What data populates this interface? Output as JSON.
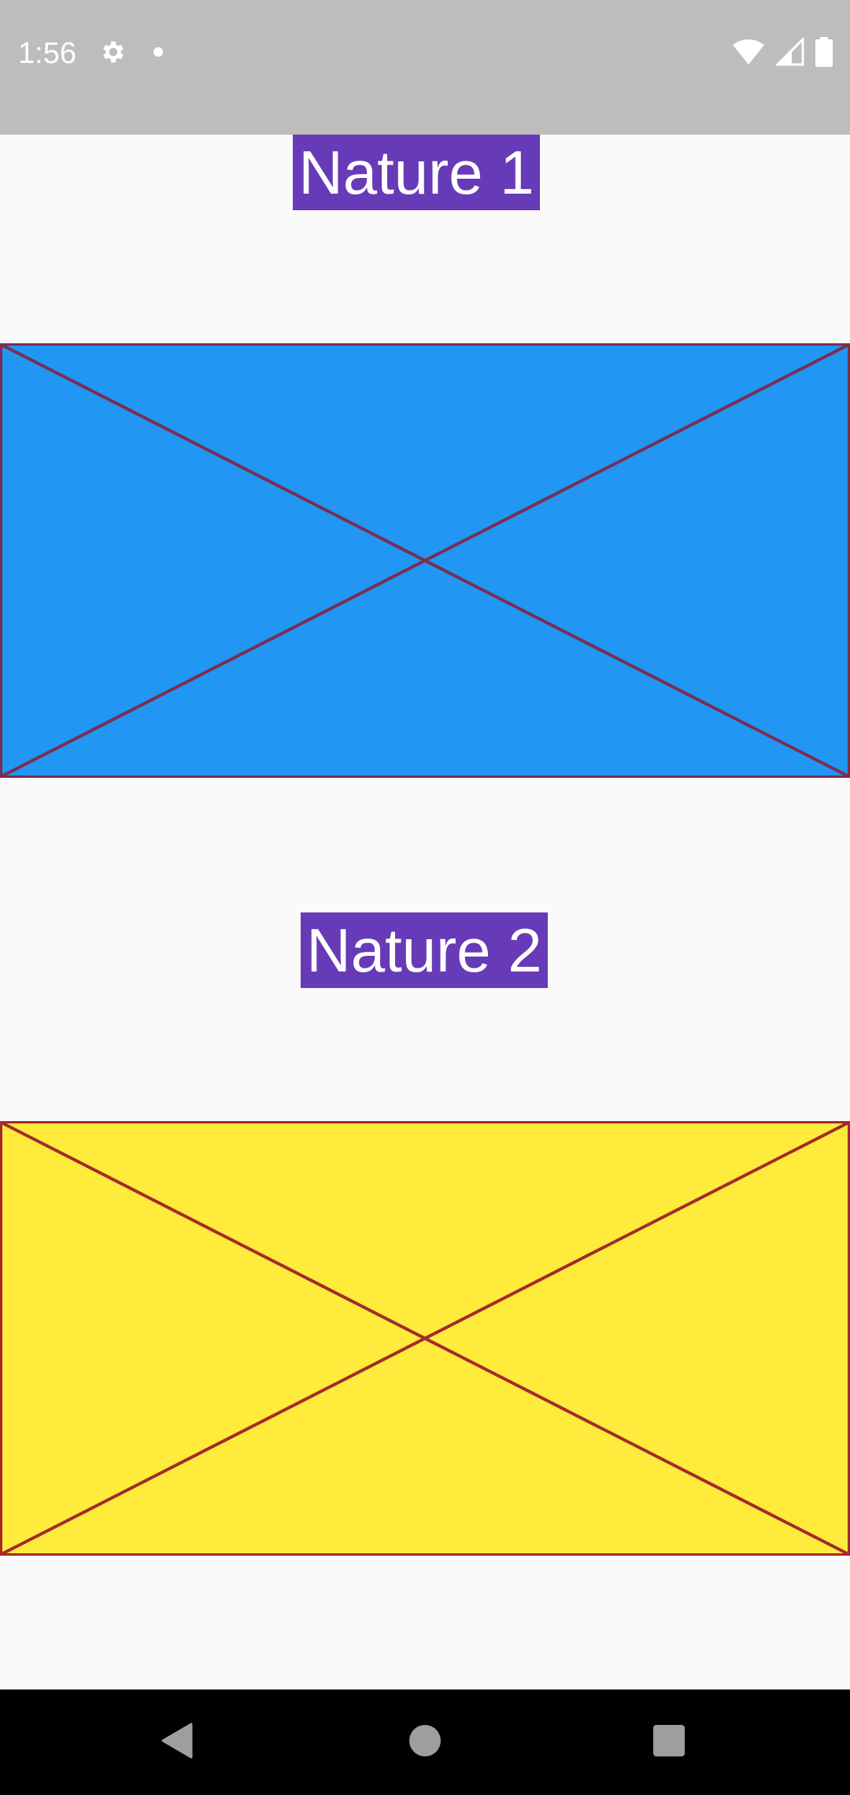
{
  "status_bar": {
    "time": "1:56",
    "left_icons": [
      "gear-icon",
      "dot-icon"
    ],
    "right_icons": [
      "wifi-icon",
      "signal-icon",
      "battery-icon"
    ],
    "background_color": "#BDBDBD"
  },
  "items": [
    {
      "title": "Nature 1",
      "label_color": "#673AB7",
      "placeholder_fill": "#2196F3",
      "placeholder_stroke": "#7B2D52"
    },
    {
      "title": "Nature 2",
      "label_color": "#673AB7",
      "placeholder_fill": "#FFEB3B",
      "placeholder_stroke": "#A52A2A"
    }
  ],
  "nav_bar": {
    "buttons": [
      "back-icon",
      "home-icon",
      "recents-icon"
    ]
  }
}
